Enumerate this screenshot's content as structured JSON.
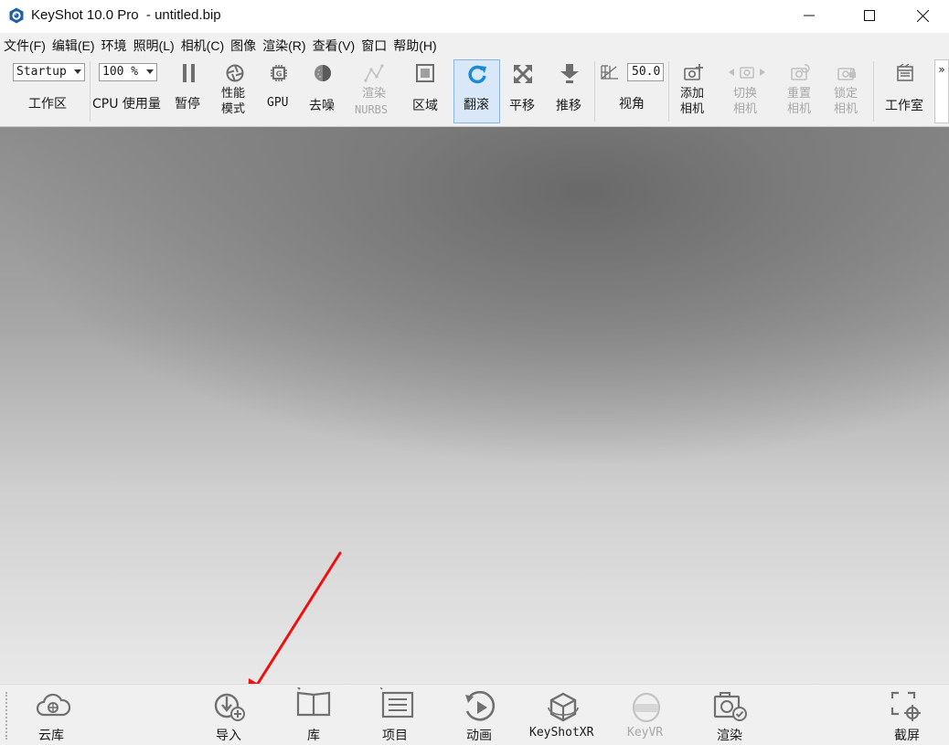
{
  "window": {
    "title": "KeyShot 10.0 Pro  - untitled.bip",
    "minimize": "—",
    "maximize": "☐",
    "close": "✕"
  },
  "menu": [
    "文件(F)",
    "编辑(E)",
    "环境",
    "照明(L)",
    "相机(C)",
    "图像",
    "渲染(R)",
    "查看(V)",
    "窗口",
    "帮助(H)"
  ],
  "toolbar": {
    "workspace_value": "Startup",
    "workspace_label": "工作区",
    "cpu_value": "100 %",
    "cpu_label": "CPU 使用量",
    "pause": "暂停",
    "performance_line1": "性能",
    "performance_line2": "模式",
    "gpu": "GPU",
    "denoise": "去噪",
    "render_nurbs_line1": "渲染",
    "render_nurbs_line2": "NURBS",
    "region": "区域",
    "tumble": "翻滚",
    "pan": "平移",
    "dolly": "推移",
    "fov_value": "50.0",
    "fov_label": "视角",
    "add_camera_line1": "添加",
    "add_camera_line2": "相机",
    "switch_camera_line1": "切换",
    "switch_camera_line2": "相机",
    "reset_camera_line1": "重置",
    "reset_camera_line2": "相机",
    "lock_camera_line1": "锁定",
    "lock_camera_line2": "相机",
    "studio": "工作室",
    "overflow": "»"
  },
  "bottom": {
    "cloud_library": "云库",
    "import": "导入",
    "library": "库",
    "project": "项目",
    "animation": "动画",
    "keyshotxr": "KeyShotXR",
    "keyvr": "KeyVR",
    "render": "渲染",
    "screenshot": "截屏"
  },
  "colors": {
    "accent": "#1a8ad4",
    "annotation": "#ee1111",
    "active_bg": "#d8e8f8"
  }
}
